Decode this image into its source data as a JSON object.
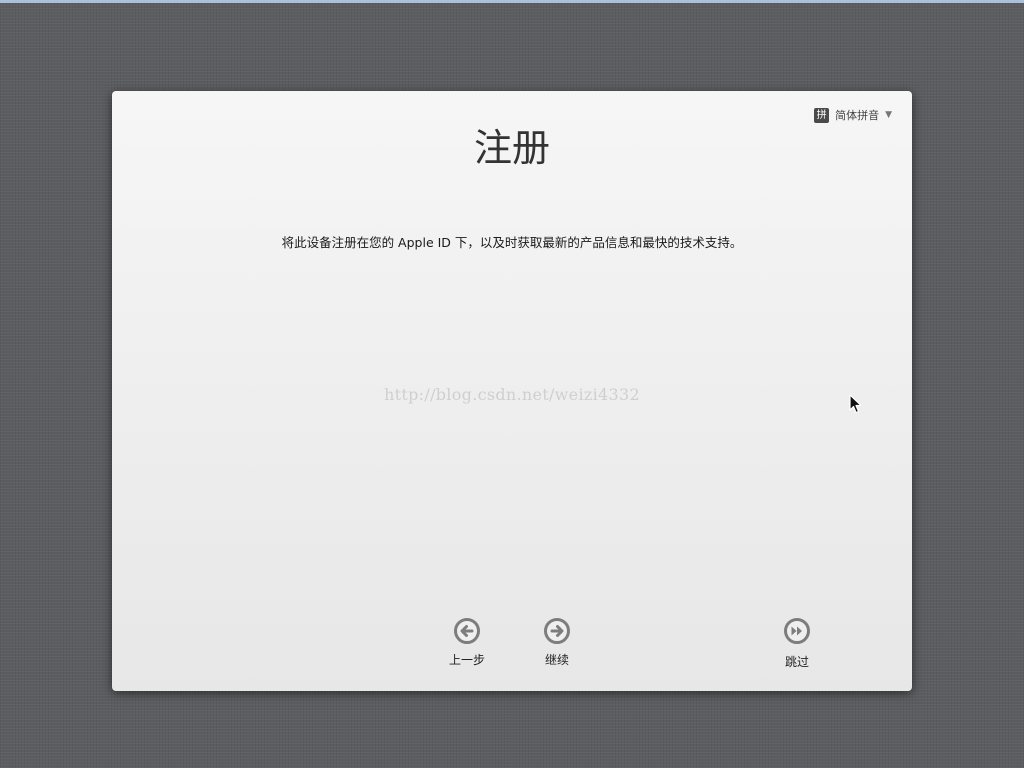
{
  "window": {
    "title": "注册"
  },
  "input_menu": {
    "icon_text": "拼",
    "label": "简体拼音",
    "caret": "▼"
  },
  "content": {
    "description": "将此设备注册在您的 Apple ID 下，以及时获取最新的产品信息和最快的技术支持。",
    "watermark": "http://blog.csdn.net/weizi4332"
  },
  "navigation": {
    "back_label": "上一步",
    "continue_label": "继续",
    "skip_label": "跳过"
  },
  "icons": {
    "back": "arrow-left-circle-icon",
    "continue": "arrow-right-circle-icon",
    "skip": "fast-forward-circle-icon",
    "cursor": "mouse-pointer-icon"
  },
  "colors": {
    "background": "#5c5d60",
    "panel": "#f2f2f2",
    "button_ring": "#7d7d7d",
    "title_text": "#333333"
  }
}
